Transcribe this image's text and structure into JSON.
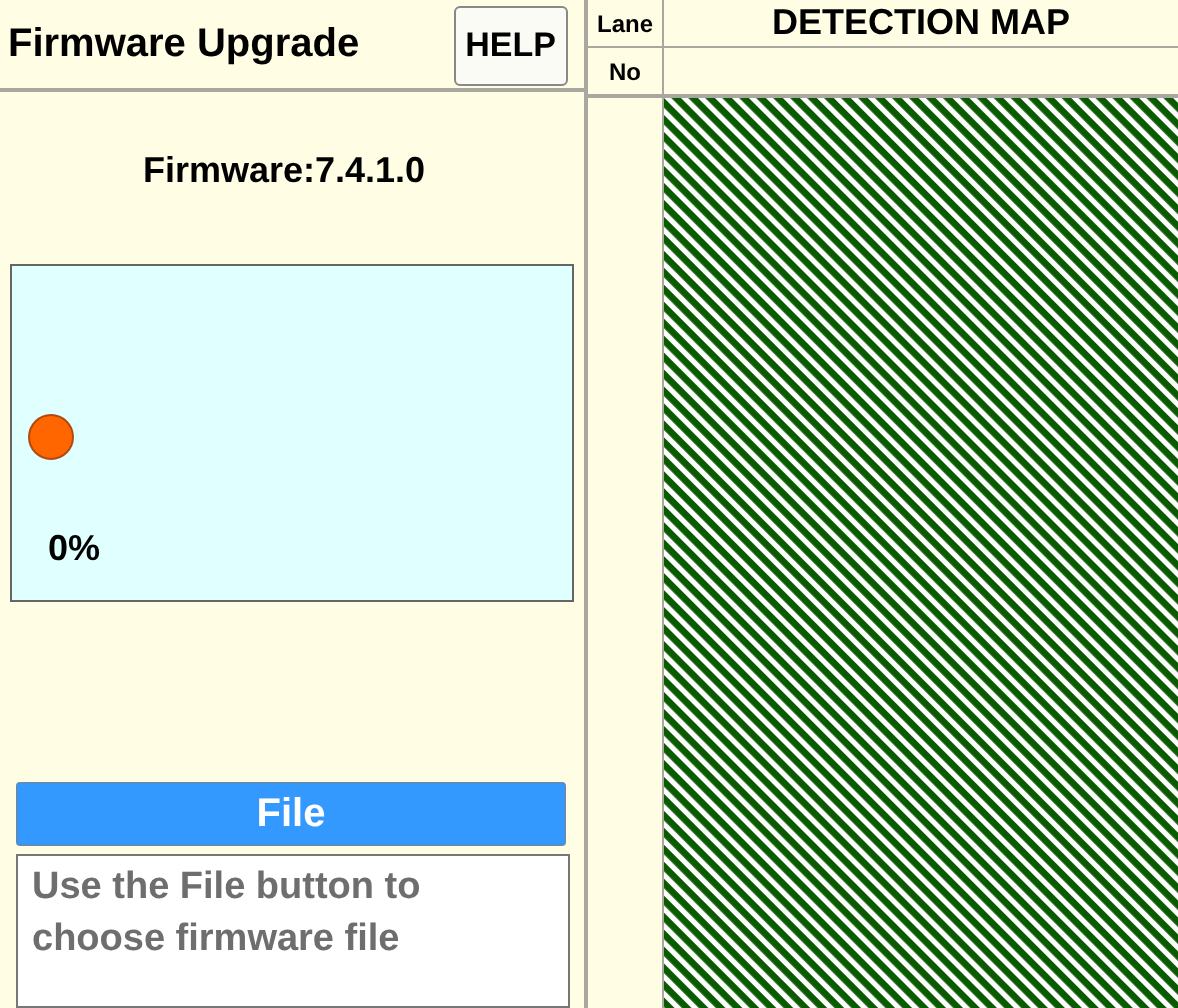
{
  "header": {
    "title": "Firmware Upgrade",
    "help_button": "HELP"
  },
  "firmware": {
    "version": "Firmware:7.4.1.0"
  },
  "progress": {
    "reading": "0%"
  },
  "file_button": "File",
  "message": "Use the File button to choose firmware file",
  "lane_column": {
    "line_1": "Lane",
    "line_2": "No"
  },
  "map": {
    "title": "DETECTION MAP"
  }
}
